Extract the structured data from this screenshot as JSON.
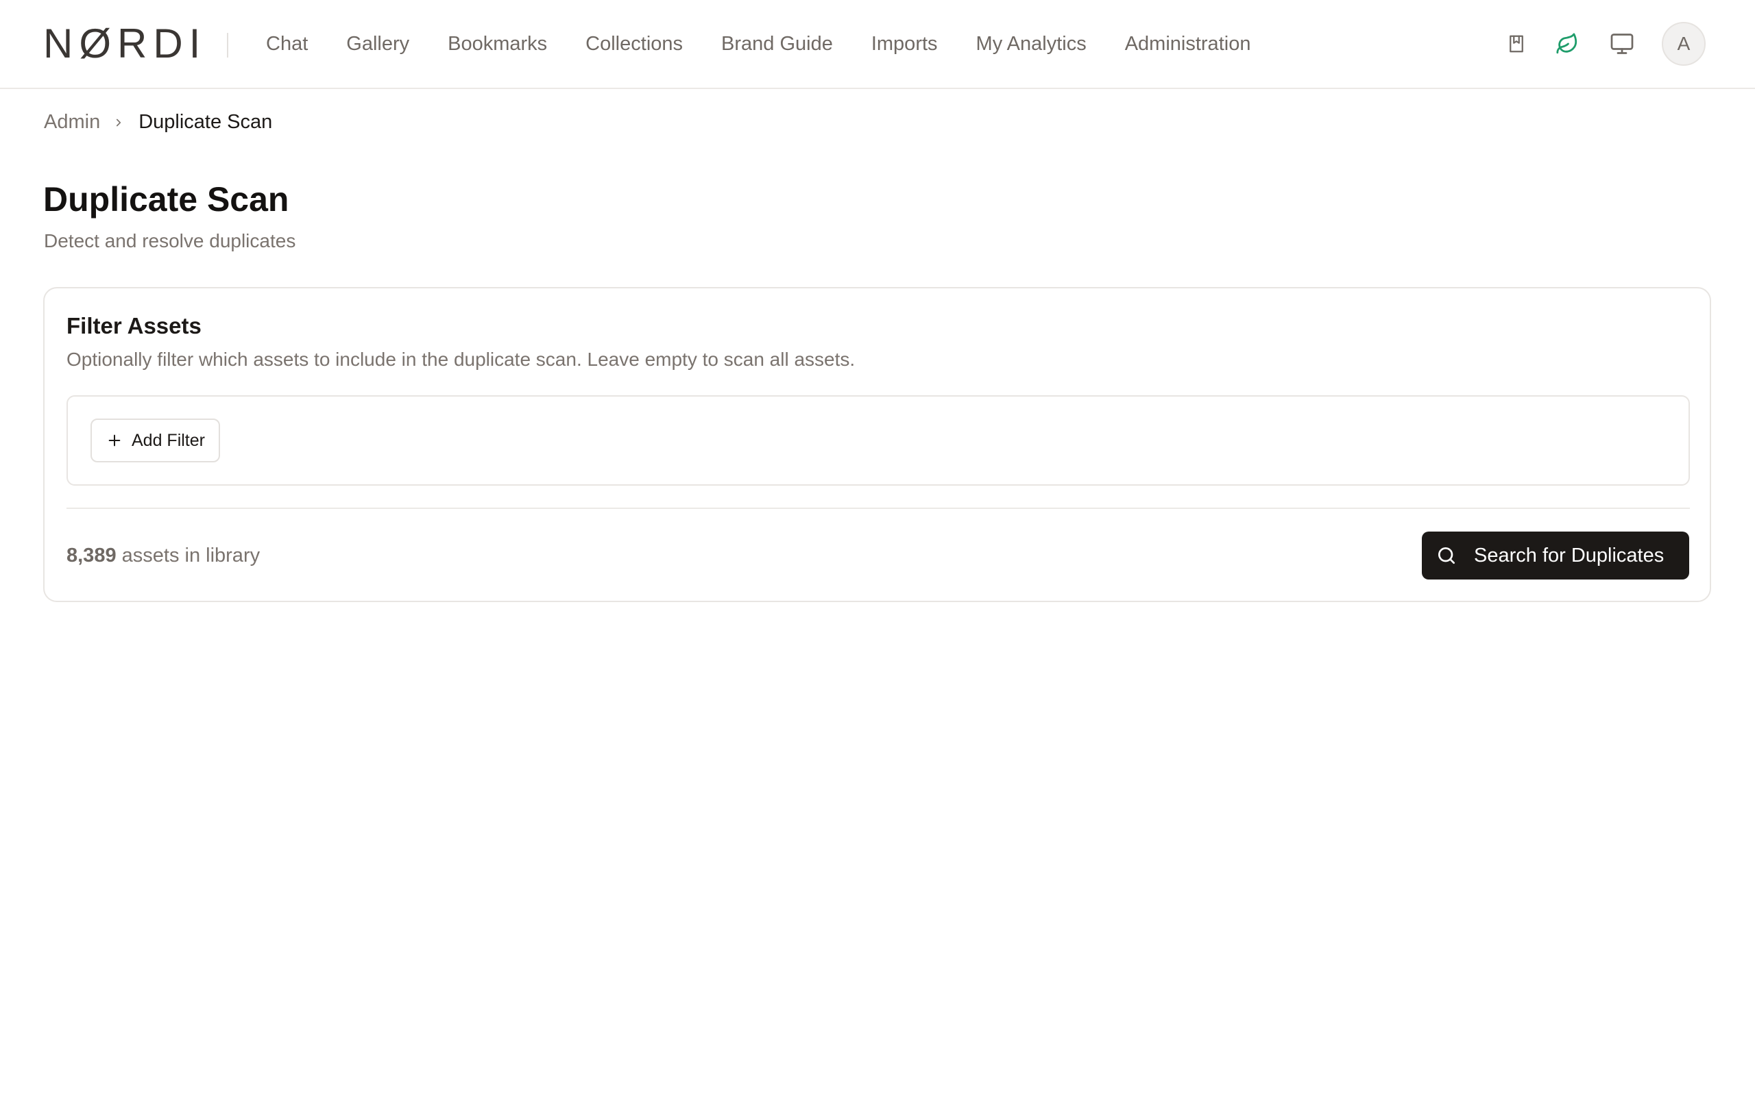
{
  "brand": {
    "logo_text": "NØRDI"
  },
  "nav": {
    "items": [
      {
        "label": "Chat"
      },
      {
        "label": "Gallery"
      },
      {
        "label": "Bookmarks"
      },
      {
        "label": "Collections"
      },
      {
        "label": "Brand Guide"
      },
      {
        "label": "Imports"
      },
      {
        "label": "My Analytics"
      },
      {
        "label": "Administration"
      }
    ]
  },
  "toolbar": {
    "icons": [
      "bookmark-book-icon",
      "leaf-icon",
      "monitor-icon"
    ],
    "avatar_initial": "A"
  },
  "breadcrumb": {
    "parent": "Admin",
    "current": "Duplicate Scan"
  },
  "page": {
    "title": "Duplicate Scan",
    "subtitle": "Detect and resolve duplicates"
  },
  "filter_card": {
    "title": "Filter Assets",
    "description": "Optionally filter which assets to include in the duplicate scan. Leave empty to scan all assets.",
    "add_filter_label": "Add Filter",
    "asset_count": "8,389",
    "asset_count_suffix": "assets in library",
    "search_button_label": "Search for Duplicates"
  },
  "colors": {
    "primary_button": "#1c1917",
    "leaf_icon": "#1f9d6b",
    "muted_text": "#7a736e"
  }
}
